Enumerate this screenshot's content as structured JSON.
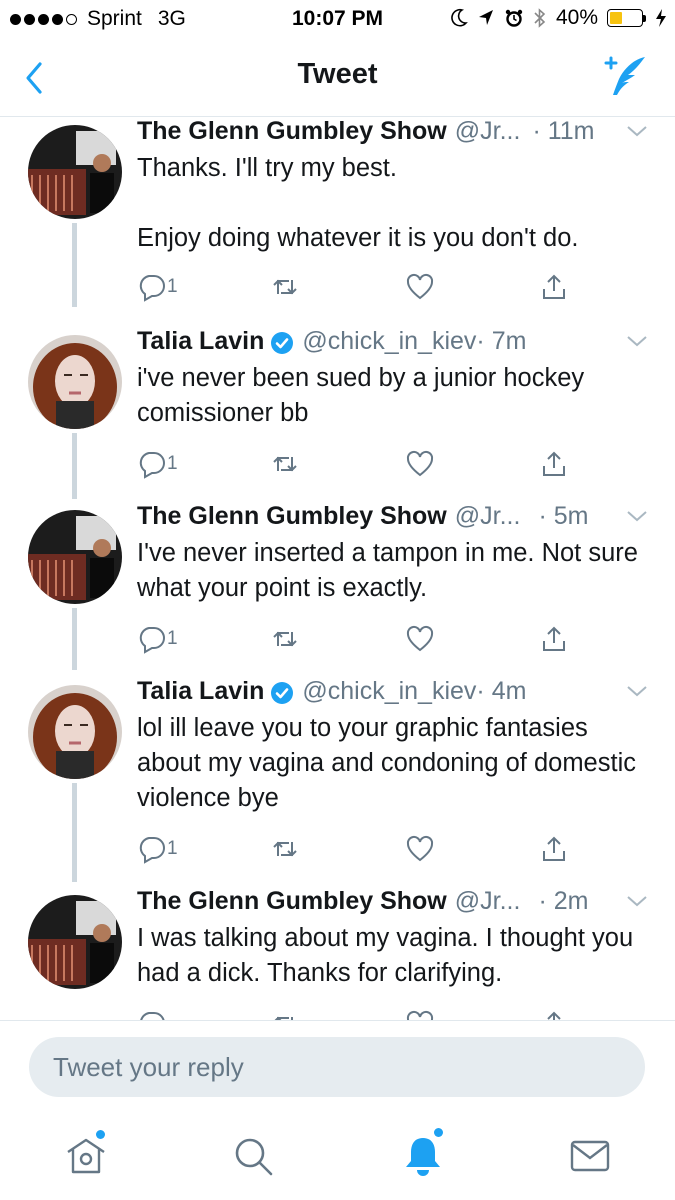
{
  "status_bar": {
    "carrier": "Sprint",
    "network": "3G",
    "time": "10:07 PM",
    "battery": "40%",
    "battery_level": 0.4
  },
  "nav": {
    "title": "Tweet",
    "back_icon": "chevron-left-icon",
    "compose_icon": "compose-tweet-icon"
  },
  "tweets": [
    {
      "name": "The Glenn Gumbley Show",
      "handle": "@Jr...",
      "time": "· 11m",
      "verified": false,
      "paragraphs": [
        "Thanks. I'll try my best.",
        "Enjoy doing whatever it is you don't do."
      ],
      "reply_count": "1"
    },
    {
      "name": "Talia Lavin",
      "handle": "@chick_in_kiev",
      "time": "· 7m",
      "verified": true,
      "paragraphs": [
        "i've never been sued by a junior hockey comissioner bb"
      ],
      "reply_count": "1"
    },
    {
      "name": "The Glenn Gumbley Show",
      "handle": "@Jr...",
      "time": "· 5m",
      "verified": false,
      "paragraphs": [
        "I've never inserted a tampon in me. Not sure what your point is exactly."
      ],
      "reply_count": "1"
    },
    {
      "name": "Talia Lavin",
      "handle": "@chick_in_kiev",
      "time": "· 4m",
      "verified": true,
      "paragraphs": [
        "lol ill leave you to your graphic fantasies about my vagina and condoning of domestic violence bye"
      ],
      "reply_count": "1"
    },
    {
      "name": "The Glenn Gumbley Show",
      "handle": "@Jr...",
      "time": "· 2m",
      "verified": false,
      "paragraphs": [
        "I was talking about my vagina. I thought you had a dick. Thanks for clarifying."
      ],
      "reply_count": ""
    }
  ],
  "reply": {
    "placeholder": "Tweet your reply"
  },
  "tabs": [
    {
      "icon": "home-icon",
      "notification_dot": true
    },
    {
      "icon": "search-icon",
      "notification_dot": false
    },
    {
      "icon": "notifications-bell-icon",
      "notification_dot": true,
      "active": true
    },
    {
      "icon": "messages-envelope-icon",
      "notification_dot": false
    }
  ],
  "colors": {
    "accent": "#1da1f2",
    "text": "#14171a",
    "secondary_text": "#657786",
    "thread_line": "#ccd6dd",
    "verified": "#1da1f2",
    "battery_fill": "#f7c30f"
  }
}
